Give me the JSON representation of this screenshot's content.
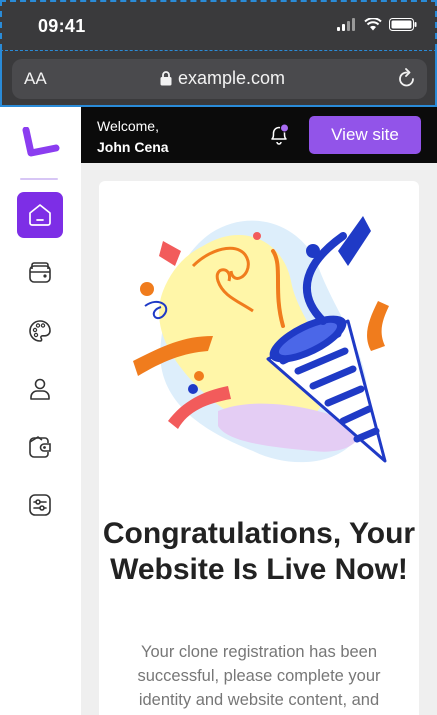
{
  "status_bar": {
    "time": "09:41"
  },
  "browser": {
    "text_size_label": "AA",
    "url": "example.com"
  },
  "header": {
    "welcome_line": "Welcome,",
    "user_name": "John Cena",
    "view_site_label": "View site"
  },
  "sidebar": {
    "items": [
      {
        "name": "home",
        "icon": "home-icon",
        "active": true
      },
      {
        "name": "wallet",
        "icon": "wallet-icon",
        "active": false
      },
      {
        "name": "palette",
        "icon": "palette-icon",
        "active": false
      },
      {
        "name": "profile",
        "icon": "user-icon",
        "active": false
      },
      {
        "name": "billing",
        "icon": "wallet-coin-icon",
        "active": false
      },
      {
        "name": "settings",
        "icon": "sliders-icon",
        "active": false
      }
    ]
  },
  "main": {
    "heading": "Congratulations, Your Website Is Live Now!",
    "body": "Your clone registration has been successful, please complete your identity and website content, and"
  },
  "colors": {
    "accent": "#7d2ee6",
    "button": "#9254e9",
    "topbar": "#0b0b0b"
  }
}
